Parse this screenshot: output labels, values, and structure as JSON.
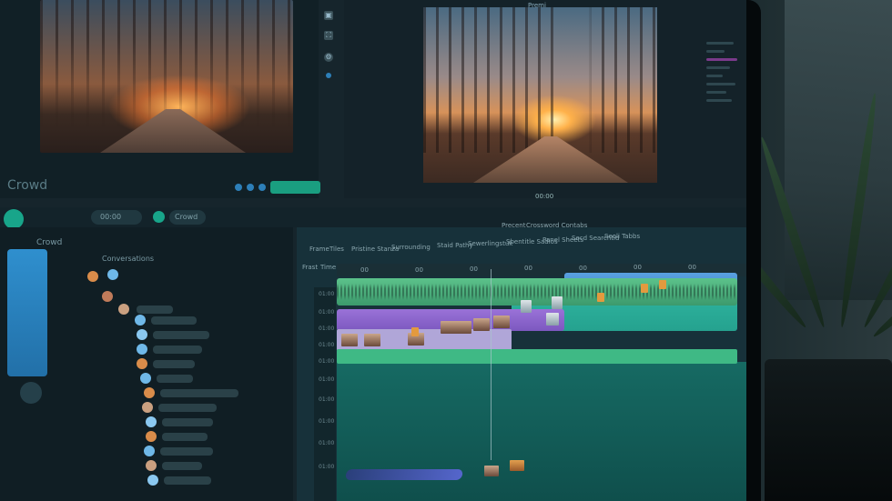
{
  "window": {
    "title": "Premi"
  },
  "source_monitor": {
    "label": "Crowd"
  },
  "program_monitor": {
    "timecode": "00:00"
  },
  "header_bar": {
    "project_label": "Crowd",
    "pill_left": "00:00",
    "pill_mid": "Crowd"
  },
  "timeline_toolbar": {
    "label_a": "Precent",
    "label_b": "Crossword Contabs",
    "row_items": [
      "Frame",
      "Tiles",
      "Pristine Stanza",
      "Surrounding",
      "Staid Pathy",
      "Sewerlingstuk",
      "Sbentitle Sadios",
      "Panel Sheets",
      "Secd Searchtid",
      "Seoli Tabbs"
    ]
  },
  "timeline": {
    "left_labels": [
      "Frast",
      "Time"
    ],
    "ruler_ticks": [
      "00",
      "00",
      "00",
      "00",
      "00",
      "00",
      "00"
    ],
    "track_labels": [
      "01:00",
      "01:00",
      "01:00",
      "01:00",
      "01:00",
      "01:00",
      "01:00",
      "01:00",
      "01:00",
      "01:00"
    ]
  },
  "media_browser": {
    "tab": "Crowd",
    "header": "Conversations"
  },
  "colors": {
    "accent_teal": "#18a58a",
    "clip_purple": "#8a64cc",
    "clip_green": "#4fb37d",
    "clip_blue": "#4a92d6"
  }
}
